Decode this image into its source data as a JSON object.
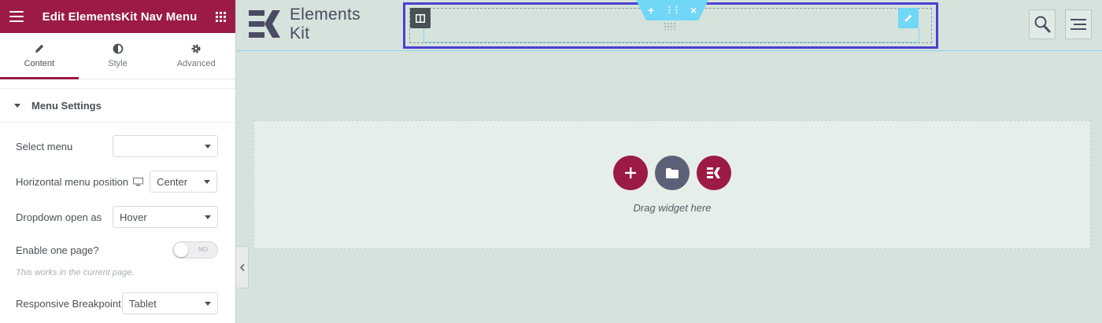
{
  "sidebar": {
    "header_title": "Edit ElementsKit Nav Menu",
    "tabs": [
      {
        "label": "Content",
        "icon": "pencil-icon"
      },
      {
        "label": "Style",
        "icon": "half-circle-icon"
      },
      {
        "label": "Advanced",
        "icon": "gear-icon"
      }
    ],
    "section_title": "Menu Settings",
    "controls": {
      "select_menu": {
        "label": "Select menu",
        "value": ""
      },
      "horizontal_position": {
        "label": "Horizontal menu position",
        "value": "Center"
      },
      "dropdown_open": {
        "label": "Dropdown open as",
        "value": "Hover"
      },
      "one_page": {
        "label": "Enable one page?",
        "toggle_text": "NO",
        "enabled": false
      },
      "one_page_note": "This works in the current page.",
      "responsive_breakpoint": {
        "label": "Responsive Breakpoint",
        "value": "Tablet"
      }
    }
  },
  "canvas": {
    "logo": {
      "line1": "Elements",
      "line2": "Kit"
    },
    "section_toolbar": {
      "add": "+",
      "move": "⋮⋮",
      "remove": "×"
    },
    "header_icons": [
      "search-icon",
      "menu-icon"
    ],
    "drop_zone_text": "Drag widget here"
  },
  "colors": {
    "brand": "#9b1b45",
    "canvas_bg": "#d5e3dc",
    "selection": "#4b3fd2",
    "accent_cyan": "#71d7f7",
    "folder_button": "#5c6178"
  }
}
